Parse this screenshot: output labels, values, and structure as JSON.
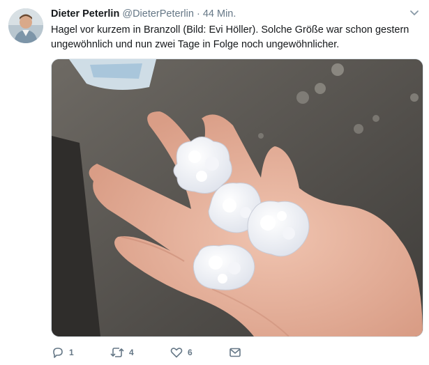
{
  "tweet": {
    "author_name": "Dieter Peterlin",
    "handle": "@DieterPeterlin",
    "separator": "·",
    "time": "44 Min.",
    "text": "Hagel vor kurzem in Branzoll (Bild: Evi Höller). Solche Größe war schon gestern ungewöhnlich und nun zwei Tage in Folge noch ungewöhnlicher."
  },
  "actions": {
    "reply_count": "1",
    "retweet_count": "4",
    "like_count": "6"
  },
  "colors": {
    "text_primary": "#14171a",
    "text_secondary": "#657786",
    "border": "#e1e8ed"
  },
  "icons": [
    "avatar",
    "chevron-down-icon",
    "reply-icon",
    "retweet-icon",
    "like-icon",
    "message-icon"
  ]
}
